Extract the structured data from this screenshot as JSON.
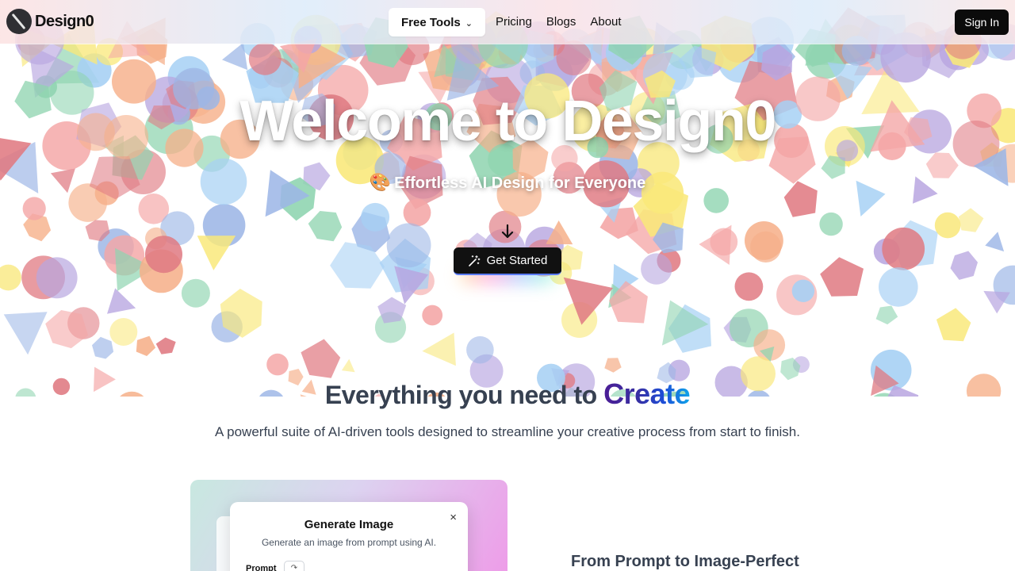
{
  "brand": {
    "name": "Design0",
    "logo_icon": "brush-icon"
  },
  "nav": {
    "free_tools": "Free Tools",
    "pricing": "Pricing",
    "blogs": "Blogs",
    "about": "About",
    "sign_in": "Sign In"
  },
  "hero": {
    "title": "Welcome to Design0",
    "subtitle_emoji": "🎨",
    "subtitle": "Effortless AI Design for Everyone",
    "cta": "Get Started"
  },
  "features_section": {
    "title_prefix": "Everything you need to",
    "title_accent": "Create",
    "description": "A powerful suite of AI-driven tools designed to streamline your creative process from start to finish."
  },
  "feature_card": {
    "dialog_title": "Generate Image",
    "dialog_description": "Generate an image from prompt using AI.",
    "prompt_label": "Prompt",
    "close_glyph": "×"
  },
  "feature_heading": "From Prompt to Image-Perfect",
  "colors": {
    "confetti": [
      "#f4a6a6",
      "#a6d0f4",
      "#f9e87a",
      "#b8a6e0",
      "#8fd4b0",
      "#f6b08a",
      "#e07a82",
      "#9cb6e6"
    ],
    "accent_gradient": [
      "#4c1d95",
      "#1d4ed8",
      "#0ea5e9"
    ],
    "cta_bg": "#111111"
  }
}
